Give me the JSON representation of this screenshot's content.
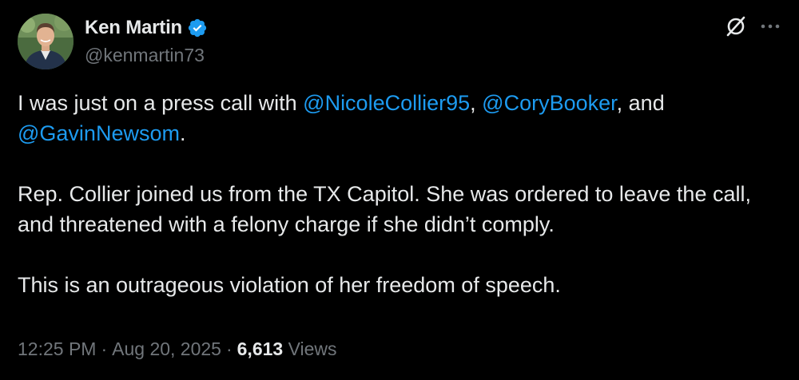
{
  "author": {
    "name": "Ken Martin",
    "handle": "@kenmartin73",
    "verified_color": "#1d9bf0"
  },
  "icons": {
    "avatar": "profile-photo",
    "verified": "verified-badge-icon",
    "grok": "grok-icon",
    "more": "more-options-icon"
  },
  "body": {
    "para1": {
      "t1": "I was just on a press call with ",
      "m1": "@NicoleCollier95",
      "t2": ", ",
      "m2": "@CoryBooker",
      "t3": ", and ",
      "m3": "@GavinNewsom",
      "t4": "."
    },
    "para2": "Rep. Collier joined us from the TX Capitol. She was ordered to leave the call, and threatened with a felony charge if she didn’t comply.",
    "para3": "This is an outrageous violation of her freedom of speech."
  },
  "meta": {
    "time": "12:25 PM",
    "sep1": "·",
    "date": "Aug 20, 2025",
    "sep2": "·",
    "views_count": "6,613",
    "views_label": "Views"
  },
  "colors": {
    "background": "#000000",
    "text": "#e7e9ea",
    "secondary": "#71767b",
    "link": "#1d9bf0"
  }
}
